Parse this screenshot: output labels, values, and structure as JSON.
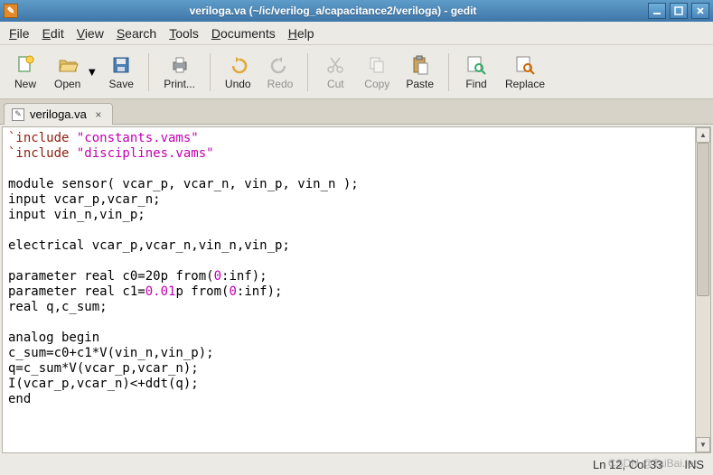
{
  "window": {
    "title": "veriloga.va (~/ic/verilog_a/capacitance2/veriloga) - gedit"
  },
  "menu": {
    "items": [
      "File",
      "Edit",
      "View",
      "Search",
      "Tools",
      "Documents",
      "Help"
    ]
  },
  "toolbar": {
    "new": "New",
    "open": "Open",
    "save": "Save",
    "print": "Print...",
    "undo": "Undo",
    "redo": "Redo",
    "cut": "Cut",
    "copy": "Copy",
    "paste": "Paste",
    "find": "Find",
    "replace": "Replace"
  },
  "tab": {
    "filename": "veriloga.va"
  },
  "code": {
    "l1a": "`include ",
    "l1b": "\"constants.vams\"",
    "l2a": "`include ",
    "l2b": "\"disciplines.vams\"",
    "l4": "module sensor( vcar_p, vcar_n, vin_p, vin_n );",
    "l5": "input vcar_p,vcar_n;",
    "l6": "input vin_n,vin_p;",
    "l8": "electrical vcar_p,vcar_n,vin_n,vin_p;",
    "l10a": "parameter real c0=20p from(",
    "l10b": "0",
    "l10c": ":inf);",
    "l11a": "parameter real c1=",
    "l11b": "0.01",
    "l11c": "p from(",
    "l11d": "0",
    "l11e": ":inf);",
    "l12": "real q,c_sum;",
    "l14": "analog begin",
    "l15": "c_sum=c0+c1*V(vin_n,vin_p);",
    "l16": "q=c_sum*V(vcar_p,vcar_n);",
    "l17": "I(vcar_p,vcar_n)<+ddt(q);",
    "l18": "end"
  },
  "status": {
    "pos": "Ln 12, Col 33",
    "mode": "INS"
  },
  "watermark": "CSDN @TaiBai.let"
}
